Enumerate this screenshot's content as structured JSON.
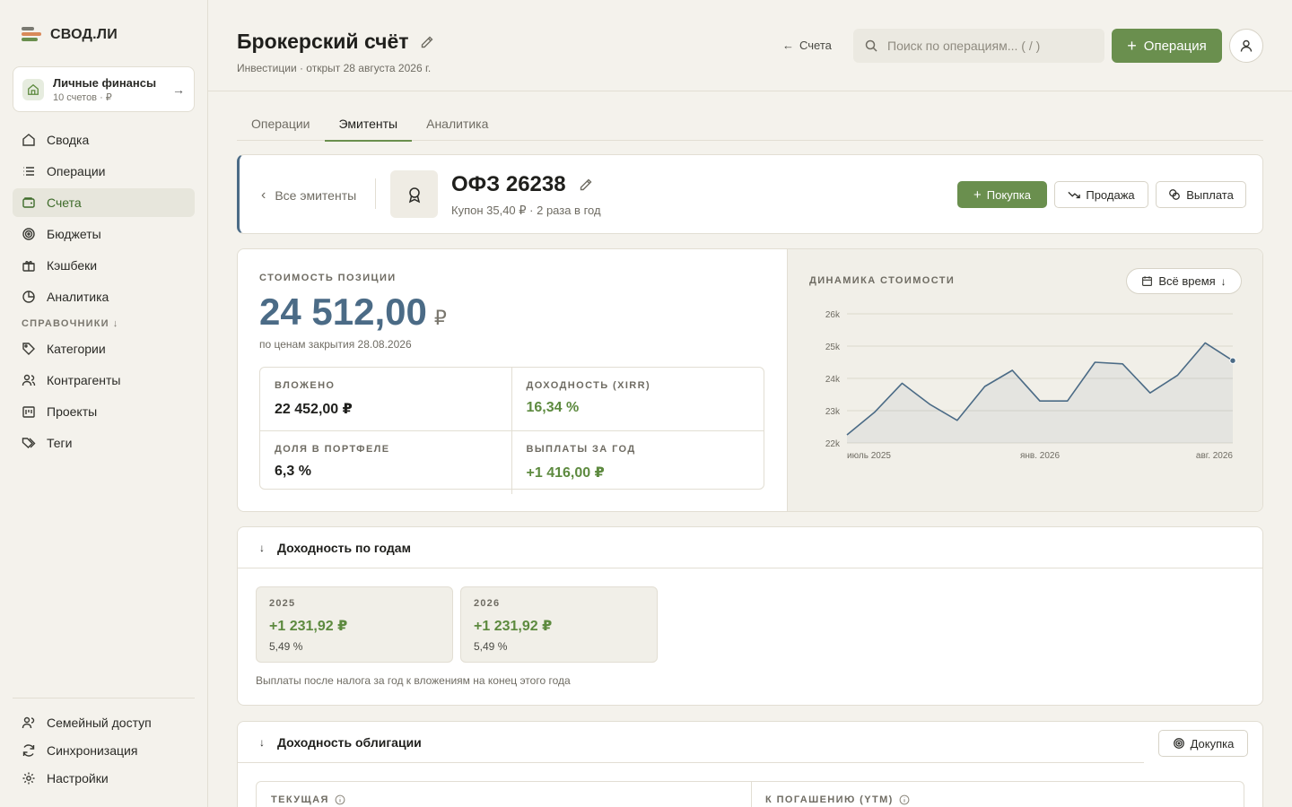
{
  "app": {
    "logo": "СВОД.ЛИ"
  },
  "workspace": {
    "title": "Личные финансы",
    "sub": "10 счетов · ₽"
  },
  "nav": {
    "items": [
      {
        "label": "Сводка",
        "icon": "home-icon"
      },
      {
        "label": "Операции",
        "icon": "list-icon"
      },
      {
        "label": "Счета",
        "icon": "wallet-icon"
      },
      {
        "label": "Бюджеты",
        "icon": "target-icon"
      },
      {
        "label": "Кэшбеки",
        "icon": "gift-icon"
      },
      {
        "label": "Аналитика",
        "icon": "pie-chart-icon"
      }
    ],
    "section_label": "СПРАВОЧНИКИ",
    "ref_items": [
      {
        "label": "Категории",
        "icon": "tag-icon"
      },
      {
        "label": "Контрагенты",
        "icon": "users-icon"
      },
      {
        "label": "Проекты",
        "icon": "folder-icon"
      },
      {
        "label": "Теги",
        "icon": "tags-icon"
      }
    ],
    "footer_items": [
      {
        "label": "Семейный доступ",
        "icon": "family-icon"
      },
      {
        "label": "Синхронизация",
        "icon": "sync-icon"
      },
      {
        "label": "Настройки",
        "icon": "gear-icon"
      }
    ],
    "active_index": 2
  },
  "header": {
    "title": "Брокерский счёт",
    "subtitle": "Инвестиции · открыт 28 августа 2026 г.",
    "back_label": "Счета",
    "search_placeholder": "Поиск по операциям... ( / )",
    "primary_label": "Операция"
  },
  "tabs": [
    {
      "label": "Операции"
    },
    {
      "label": "Эмитенты"
    },
    {
      "label": "Аналитика"
    }
  ],
  "active_tab": 1,
  "issuer": {
    "back_label": "Все эмитенты",
    "name": "ОФЗ 26238",
    "sub": "Купон 35,40 ₽ · 2 раза в год",
    "buy_label": "Покупка",
    "sell_label": "Продажа",
    "payout_label": "Выплата"
  },
  "position": {
    "caption": "СТОИМОСТЬ ПОЗИЦИИ",
    "value": "24 512,00",
    "currency": "₽",
    "note": "по ценам закрытия 28.08.2026",
    "stats": [
      {
        "label": "ВЛОЖЕНО",
        "value": "22 452,00 ₽",
        "color": "#1f1f1c"
      },
      {
        "label": "ДОХОДНОСТЬ (XIRR)",
        "value": "16,34 %",
        "color": "#5d8a3f"
      },
      {
        "label": "ДОЛЯ В ПОРТФЕЛЕ",
        "value": "6,3 %",
        "color": "#1f1f1c"
      },
      {
        "label": "ВЫПЛАТЫ ЗА ГОД",
        "value": "+1 416,00 ₽",
        "color": "#5d8a3f"
      }
    ]
  },
  "chart_caption": "ДИНАМИКА СТОИМОСТИ",
  "range_label": "Всё время",
  "chart_data": {
    "type": "area",
    "title": "ДИНАМИКА СТОИМОСТИ",
    "ytick_labels": [
      "26k",
      "25k",
      "24k",
      "23k",
      "22k"
    ],
    "ylim": [
      22000,
      26000
    ],
    "xtick_labels": [
      "июль 2025",
      "янв. 2026",
      "авг. 2026"
    ],
    "series": [
      {
        "values": [
          22250,
          22950,
          23850,
          23200,
          22700,
          23750,
          24250,
          23300,
          23300,
          24500,
          24450,
          23550,
          24100,
          25100,
          24550
        ]
      }
    ],
    "color": "#4b6b86",
    "grid": true
  },
  "yearly": {
    "title": "Доходность по годам",
    "tiles": [
      {
        "year": "2025",
        "amount": "+1 231,92 ₽",
        "pct": "5,49 %"
      },
      {
        "year": "2026",
        "amount": "+1 231,92 ₽",
        "pct": "5,49 %"
      }
    ],
    "note": "Выплаты после налога за год к вложениям на конец этого года"
  },
  "bond": {
    "title": "Доходность облигации",
    "topup_label": "Докупка",
    "current_label": "ТЕКУЩАЯ",
    "ytm_label": "К ПОГАШЕНИЮ (YTM)"
  }
}
